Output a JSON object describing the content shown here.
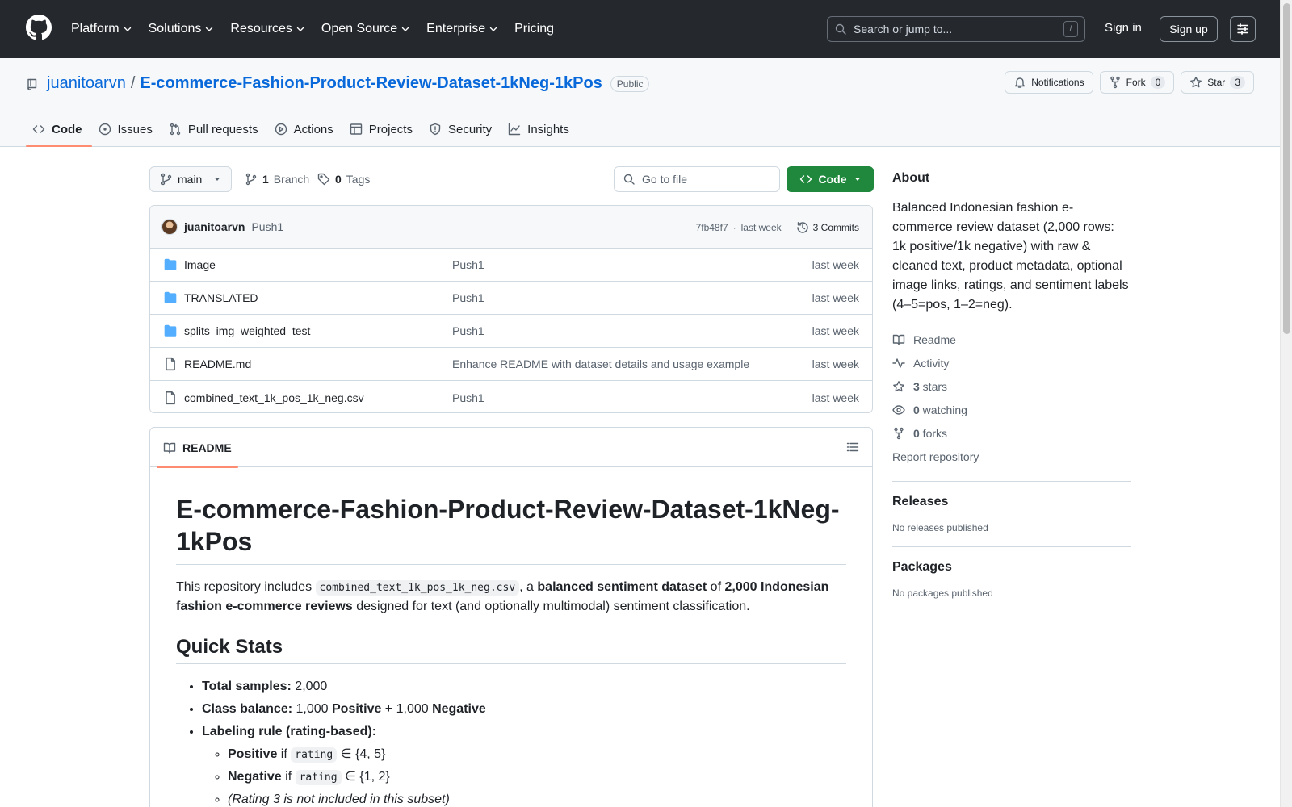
{
  "header": {
    "nav": [
      "Platform",
      "Solutions",
      "Resources",
      "Open Source",
      "Enterprise",
      "Pricing"
    ],
    "search_placeholder": "Search or jump to...",
    "search_key": "/",
    "sign_in": "Sign in",
    "sign_up": "Sign up"
  },
  "repo": {
    "owner": "juanitoarvn",
    "separator": "/",
    "name": "E-commerce-Fashion-Product-Review-Dataset-1kNeg-1kPos",
    "visibility": "Public",
    "notifications_label": "Notifications",
    "fork_label": "Fork",
    "fork_count": "0",
    "star_label": "Star",
    "star_count": "3",
    "tabs": [
      {
        "label": "Code",
        "icon": "code-icon"
      },
      {
        "label": "Issues",
        "icon": "issue-icon"
      },
      {
        "label": "Pull requests",
        "icon": "pull-request-icon"
      },
      {
        "label": "Actions",
        "icon": "play-icon"
      },
      {
        "label": "Projects",
        "icon": "table-icon"
      },
      {
        "label": "Security",
        "icon": "shield-icon"
      },
      {
        "label": "Insights",
        "icon": "graph-icon"
      }
    ]
  },
  "branchbar": {
    "branch": "main",
    "branch_count": "1",
    "branch_label": "Branch",
    "tag_count": "0",
    "tag_label": "Tags",
    "goto_placeholder": "Go to file",
    "code_label": "Code"
  },
  "commit": {
    "author": "juanitoarvn",
    "message": "Push1",
    "sha": "7fb48f7",
    "dot": "·",
    "time": "last week",
    "commits_label": "3 Commits"
  },
  "files": [
    {
      "name": "Image",
      "type": "folder",
      "message": "Push1",
      "date": "last week"
    },
    {
      "name": "TRANSLATED",
      "type": "folder",
      "message": "Push1",
      "date": "last week"
    },
    {
      "name": "splits_img_weighted_test",
      "type": "folder",
      "message": "Push1",
      "date": "last week"
    },
    {
      "name": "README.md",
      "type": "file",
      "message": "Enhance README with dataset details and usage example",
      "date": "last week"
    },
    {
      "name": "combined_text_1k_pos_1k_neg.csv",
      "type": "file",
      "message": "Push1",
      "date": "last week"
    }
  ],
  "readme": {
    "tab_label": "README",
    "title": "E-commerce-Fashion-Product-Review-Dataset-1kNeg-1kPos",
    "intro": {
      "t1": "This repository includes ",
      "code": "combined_text_1k_pos_1k_neg.csv",
      "t2": ", a ",
      "b1": "balanced sentiment dataset",
      "t3": " of ",
      "b2": "2,000 Indonesian fashion e-commerce reviews",
      "t4": " designed for text (and optionally multimodal) sentiment classification."
    },
    "h2": "Quick Stats",
    "stats": {
      "total_label": "Total samples:",
      "total_value": " 2,000",
      "balance_label": "Class balance:",
      "balance_t1": " 1,000 ",
      "balance_pos": "Positive",
      "balance_t2": " + 1,000 ",
      "balance_neg": "Negative",
      "rule_label": "Labeling rule (rating-based):",
      "pos_label": "Positive",
      "if": " if ",
      "code": "rating",
      "pos_set": " ∈ {4, 5}",
      "neg_label": "Negative",
      "neg_set": " ∈ {1, 2}",
      "note": "(Rating 3 is not included in this subset)"
    }
  },
  "about": {
    "title": "About",
    "description": "Balanced Indonesian fashion e-commerce review dataset (2,000 rows: 1k positive/1k negative) with raw & cleaned text, product metadata, optional image links, ratings, and sentiment labels (4–5=pos, 1–2=neg).",
    "readme": "Readme",
    "activity": "Activity",
    "stars_count": "3",
    "stars_label": " stars",
    "watching_count": "0",
    "watching_label": " watching",
    "forks_count": "0",
    "forks_label": " forks",
    "report": "Report repository",
    "releases_title": "Releases",
    "releases_none": "No releases published",
    "packages_title": "Packages",
    "packages_none": "No packages published"
  },
  "colors": {
    "header_bg": "#25292e",
    "link": "#0969da",
    "primary_button": "#1f883d",
    "tab_underline": "#fd8c73",
    "folder": "#54aeff"
  }
}
